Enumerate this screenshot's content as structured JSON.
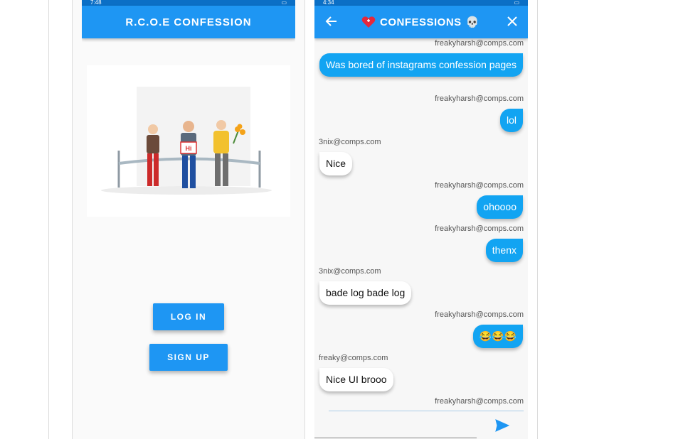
{
  "phone1": {
    "status_time": "7:48",
    "appbar_title": "R.C.O.E CONFESSION",
    "badge_text": "Hi",
    "login_label": "LOG IN",
    "signup_label": "SIGN UP"
  },
  "phone2": {
    "status_time": "4:34",
    "appbar_title": "CONFESSIONS",
    "messages": [
      {
        "sender": "freakyharsh@comps.com",
        "text": "Was bored of instagrams confession pages",
        "mine": true
      },
      {
        "sender": "freakyharsh@comps.com",
        "text": "lol",
        "mine": true
      },
      {
        "sender": "3nix@comps.com",
        "text": "Nice",
        "mine": false
      },
      {
        "sender": "freakyharsh@comps.com",
        "text": "ohoooo",
        "mine": true
      },
      {
        "sender": "freakyharsh@comps.com",
        "text": "thenx",
        "mine": true
      },
      {
        "sender": "3nix@comps.com",
        "text": "bade log bade log",
        "mine": false
      },
      {
        "sender": "freakyharsh@comps.com",
        "text": "😂😂😂",
        "mine": true
      },
      {
        "sender": "freaky@comps.com",
        "text": "Nice UI brooo",
        "mine": false
      },
      {
        "sender": "freakyharsh@comps.com",
        "text": "",
        "mine": true
      }
    ],
    "input_placeholder": ""
  },
  "colors": {
    "primary": "#1e96f3",
    "bubble_me": "#12a4f2",
    "bubble_other": "#ffffff"
  },
  "icons": [
    "back-arrow-icon",
    "heart-icon",
    "skull-icon",
    "close-icon",
    "send-icon"
  ]
}
